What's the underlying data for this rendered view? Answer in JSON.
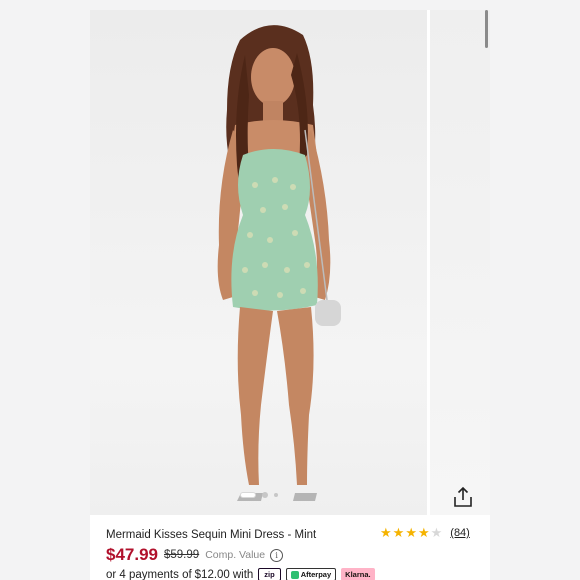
{
  "gallery": {
    "image_subject": "model wearing mint sequin mini dress",
    "slides": 3,
    "active_slide": 1,
    "share_icon": "share-upload-icon"
  },
  "product": {
    "title": "Mermaid Kisses Sequin Mini Dress - Mint",
    "rating": 4,
    "rating_max": 5,
    "review_count": "(84)",
    "price": "$47.99",
    "compare_price": "$59.99",
    "compare_label": "Comp. Value",
    "info_icon": "i"
  },
  "payments": {
    "text": "or 4 payments of",
    "amount": "$12.00",
    "with": "with",
    "providers": [
      "zip",
      "Afterpay",
      "Klarna."
    ]
  },
  "colors": {
    "price": "#b1112c",
    "star": "#f5b300",
    "dress": "#9fcfb0",
    "klarna": "#ffb3c7"
  }
}
